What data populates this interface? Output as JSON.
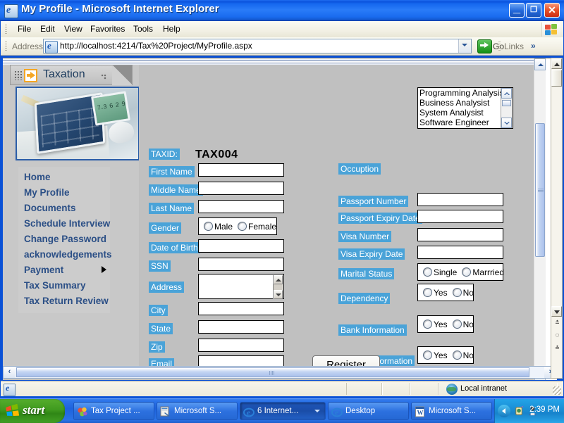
{
  "window": {
    "title": "My Profile - Microsoft Internet Explorer",
    "icon": "ie-document-icon",
    "minimize_label": "_",
    "maximize_label": "❐",
    "close_label": "✕"
  },
  "menu": {
    "items": [
      {
        "label": "File"
      },
      {
        "label": "Edit"
      },
      {
        "label": "View"
      },
      {
        "label": "Favorites"
      },
      {
        "label": "Tools"
      },
      {
        "label": "Help"
      }
    ]
  },
  "address_bar": {
    "label": "Address",
    "url": "http://localhost:4214/Tax%20Project/MyProfile.aspx",
    "go_label": "Go",
    "links_label": "Links",
    "links_overflow": "»"
  },
  "sidebar": {
    "header_title": "Taxation",
    "banner_digits": "7.3 6 2 9",
    "items": [
      {
        "label": "Home"
      },
      {
        "label": "My Profile"
      },
      {
        "label": "Documents"
      },
      {
        "label": "Schedule Interview"
      },
      {
        "label": "Change Password"
      },
      {
        "label": "acknowledgements"
      },
      {
        "label": "Payment"
      },
      {
        "label": "Tax Summary"
      },
      {
        "label": "Tax Return Review"
      }
    ]
  },
  "form": {
    "taxid_label": "TAXID:",
    "taxid_value": "TAX004",
    "left_fields": [
      {
        "label": "First Name",
        "value": ""
      },
      {
        "label": "Middle Name",
        "value": ""
      },
      {
        "label": "Last Name",
        "value": ""
      },
      {
        "label": "Date of Birth",
        "value": ""
      },
      {
        "label": "SSN",
        "value": ""
      },
      {
        "label": "Address",
        "value": ""
      },
      {
        "label": "City",
        "value": ""
      },
      {
        "label": "State",
        "value": ""
      },
      {
        "label": "Zip",
        "value": ""
      },
      {
        "label": "Email",
        "value": ""
      }
    ],
    "gender": {
      "label": "Gender",
      "options": [
        {
          "label": "Male",
          "selected": false
        },
        {
          "label": "Female",
          "selected": false
        }
      ]
    },
    "occupation": {
      "label": "Occuption",
      "options": [
        {
          "label": "Programming Analysist"
        },
        {
          "label": "Business Analysist"
        },
        {
          "label": "System Analysist"
        },
        {
          "label": "Software Engineer"
        }
      ]
    },
    "right_fields": [
      {
        "label": "Passport Number",
        "value": ""
      },
      {
        "label": "Passport Expiry Date",
        "value": ""
      },
      {
        "label": "Visa Number",
        "value": ""
      },
      {
        "label": "Visa Expiry Date",
        "value": ""
      }
    ],
    "marital_status": {
      "label": "Marital Status",
      "options": [
        {
          "label": "Single",
          "selected": false
        },
        {
          "label": "Marrried",
          "selected": false
        }
      ]
    },
    "dependency": {
      "label": "Dependency",
      "options": [
        {
          "label": "Yes",
          "selected": false
        },
        {
          "label": "No",
          "selected": false
        }
      ]
    },
    "bank_information": {
      "label": "Bank Information",
      "options": [
        {
          "label": "Yes",
          "selected": false
        },
        {
          "label": "No",
          "selected": false
        }
      ]
    },
    "vehicle_information": {
      "label": "Vehicle Information",
      "options": [
        {
          "label": "Yes",
          "selected": false
        },
        {
          "label": "No",
          "selected": false
        }
      ]
    },
    "submit_label": "Register"
  },
  "status_bar": {
    "zone_label": "Local intranet",
    "zone_icon": "globe-icon"
  },
  "taskbar": {
    "start_label": "start",
    "buttons": [
      {
        "label": "Tax Project ...",
        "icon": "vs-project-icon",
        "active": false
      },
      {
        "label": "Microsoft S...",
        "icon": "sql-server-icon",
        "active": false
      },
      {
        "label": "6 Internet...",
        "icon": "ie-icon",
        "active": true,
        "group": true
      },
      {
        "label": "Desktop",
        "icon": "ie-icon",
        "active": false
      },
      {
        "label": "Microsoft S...",
        "icon": "word-icon",
        "active": false
      }
    ],
    "clock": "2:39 PM"
  },
  "colors": {
    "title_blue": "#0a53dd",
    "label_blue": "#4aa3d8",
    "nav_link": "#2b4f86",
    "accent_orange": "#f5a623",
    "page_gray": "#c0c0c0"
  }
}
